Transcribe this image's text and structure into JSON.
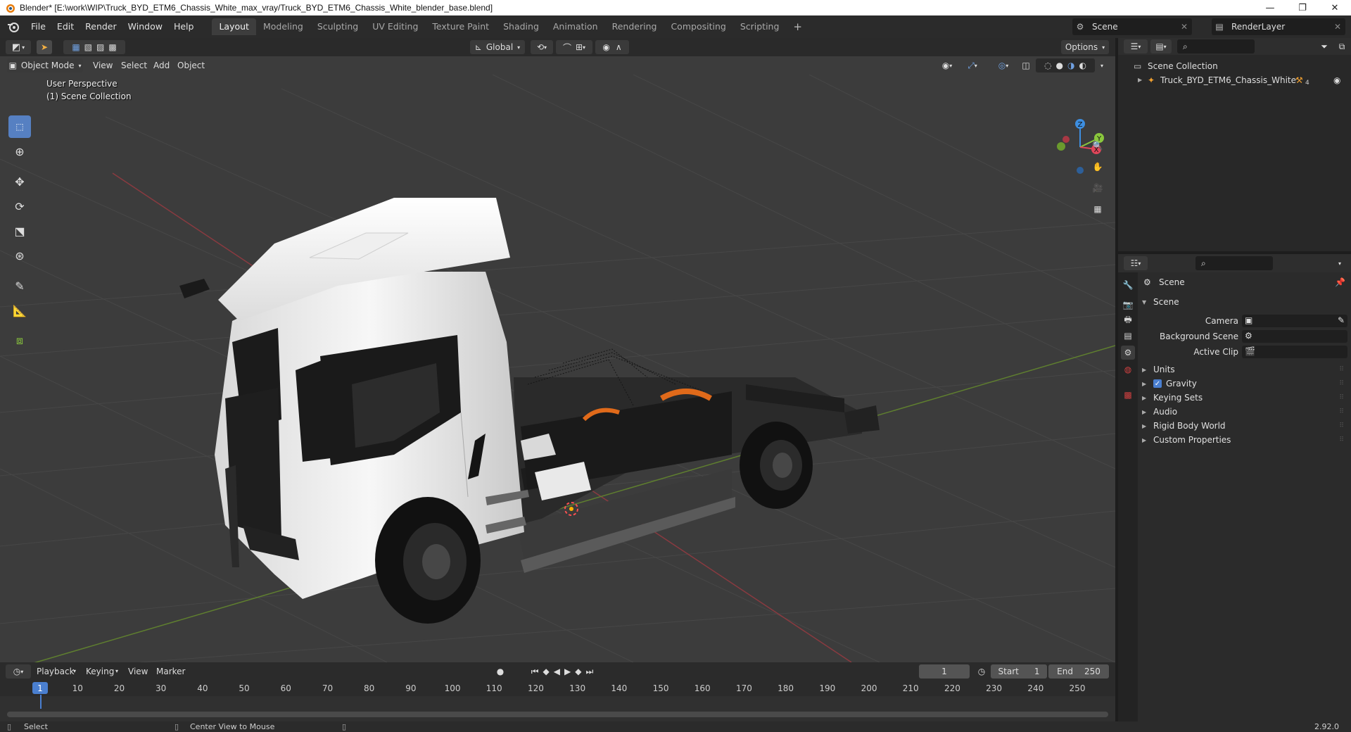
{
  "window": {
    "title": "Blender* [E:\\work\\WIP\\Truck_BYD_ETM6_Chassis_White_max_vray/Truck_BYD_ETM6_Chassis_White_blender_base.blend]",
    "minimize": "—",
    "maximize": "❐",
    "close": "✕"
  },
  "menu": {
    "items": [
      "File",
      "Edit",
      "Render",
      "Window",
      "Help"
    ]
  },
  "workspaces": {
    "tabs": [
      "Layout",
      "Modeling",
      "Sculpting",
      "UV Editing",
      "Texture Paint",
      "Shading",
      "Animation",
      "Rendering",
      "Compositing",
      "Scripting"
    ],
    "active": "Layout",
    "add": "+"
  },
  "scene_selector": {
    "scene": "Scene",
    "view_layer": "RenderLayer"
  },
  "viewport": {
    "transform_orientation": "Global",
    "options_label": "Options",
    "mode": "Object Mode",
    "menus": [
      "View",
      "Select",
      "Add",
      "Object"
    ],
    "info_line1": "User Perspective",
    "info_line2": "(1) Scene Collection",
    "gizmo": {
      "x": "X",
      "y": "Y",
      "z": "Z"
    }
  },
  "timeline": {
    "menus": [
      "Playback",
      "Keying",
      "View",
      "Marker"
    ],
    "current_frame": "1",
    "start_label": "Start",
    "start": "1",
    "end_label": "End",
    "end": "250",
    "ruler_ticks": [
      "1",
      "10",
      "20",
      "30",
      "40",
      "50",
      "60",
      "70",
      "80",
      "90",
      "100",
      "110",
      "120",
      "130",
      "140",
      "150",
      "160",
      "170",
      "180",
      "190",
      "200",
      "210",
      "220",
      "230",
      "240",
      "250"
    ]
  },
  "outliner": {
    "root": "Scene Collection",
    "items": [
      {
        "name": "Truck_BYD_ETM6_Chassis_White",
        "modifier_count": "4"
      }
    ]
  },
  "properties": {
    "context": "Scene",
    "section": "Scene",
    "fields": [
      {
        "label": "Camera"
      },
      {
        "label": "Background Scene"
      },
      {
        "label": "Active Clip"
      }
    ],
    "panels": [
      {
        "label": "Units",
        "checkbox": false
      },
      {
        "label": "Gravity",
        "checkbox": true
      },
      {
        "label": "Keying Sets",
        "checkbox": false
      },
      {
        "label": "Audio",
        "checkbox": false
      },
      {
        "label": "Rigid Body World",
        "checkbox": false
      },
      {
        "label": "Custom Properties",
        "checkbox": false
      }
    ]
  },
  "statusbar": {
    "left": "Select",
    "middle": "Center View to Mouse",
    "version": "2.92.0"
  },
  "colors": {
    "accent": "#5680c2",
    "viewport_bg": "#3c3c3c",
    "panel_bg": "#2b2b2b",
    "axis_x": "#e0465a",
    "axis_y": "#8ac73d",
    "axis_z": "#3d8ee0"
  }
}
